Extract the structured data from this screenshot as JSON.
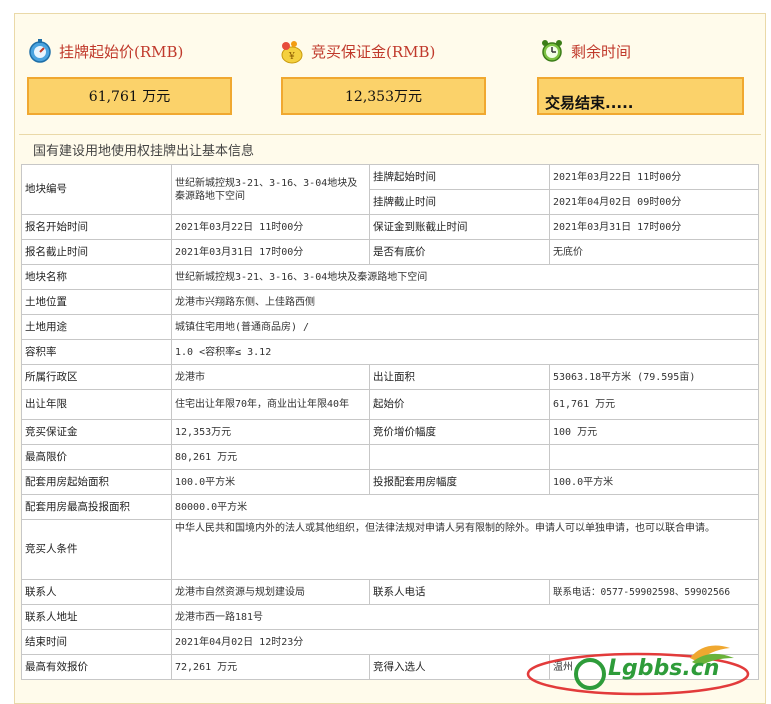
{
  "header": {
    "start_price_label": "挂牌起始价(RMB)",
    "deposit_label": "竞买保证金(RMB)",
    "remaining_label": "剩余时间",
    "start_price_value": "61,761 万元",
    "deposit_value": "12,353万元",
    "remaining_value": "交易结束....."
  },
  "section_title": "国有建设用地使用权挂牌出让基本信息",
  "rows": {
    "r1": {
      "l1": "地块编号",
      "v1": "世纪新城控规3-21、3-16、3-04地块及秦源路地下空间",
      "l2a": "挂牌起始时间",
      "v2a": "2021年03月22日 11时00分",
      "l2b": "挂牌截止时间",
      "v2b": "2021年04月02日 09时00分"
    },
    "r2": {
      "l1": "报名开始时间",
      "v1": "2021年03月22日 11时00分",
      "l2": "保证金到账截止时间",
      "v2": "2021年03月31日 17时00分"
    },
    "r3": {
      "l1": "报名截止时间",
      "v1": "2021年03月31日 17时00分",
      "l2": "是否有底价",
      "v2": "无底价"
    },
    "r4": {
      "l1": "地块名称",
      "v1": "世纪新城控规3-21、3-16、3-04地块及秦源路地下空间"
    },
    "r5": {
      "l1": "土地位置",
      "v1": "龙港市兴翔路东侧、上佳路西侧"
    },
    "r6": {
      "l1": "土地用途",
      "v1": "城镇住宅用地(普通商品房) /"
    },
    "r7": {
      "l1": "容积率",
      "v1": "1.0 <容积率≤ 3.12"
    },
    "r8": {
      "l1": "所属行政区",
      "v1": "龙港市",
      "l2": "出让面积",
      "v2": "53063.18平方米 (79.595亩)"
    },
    "r9": {
      "l1": "出让年限",
      "v1": "住宅出让年限70年，商业出让年限40年",
      "l2": "起始价",
      "v2": "61,761 万元"
    },
    "r10": {
      "l1": "竞买保证金",
      "v1": "12,353万元",
      "l2": "竞价增价幅度",
      "v2": "100 万元"
    },
    "r11": {
      "l1": "最高限价",
      "v1": "80,261 万元",
      "l2": "",
      "v2": ""
    },
    "r12": {
      "l1": "配套用房起始面积",
      "v1": "100.0平方米",
      "l2": "投报配套用房幅度",
      "v2": "100.0平方米"
    },
    "r13": {
      "l1": "配套用房最高投报面积",
      "v1": "80000.0平方米"
    },
    "r14": {
      "l1": "竞买人条件",
      "v1": "中华人民共和国境内外的法人或其他组织，但法律法规对申请人另有限制的除外。申请人可以单独申请，也可以联合申请。"
    },
    "r15": {
      "l1": "联系人",
      "v1": "龙港市自然资源与规划建设局",
      "l2": "联系人电话",
      "v2": "联系电话：0577-59902598、59902566"
    },
    "r16": {
      "l1": "联系人地址",
      "v1": "龙港市西一路181号"
    },
    "r17": {
      "l1": "结束时间",
      "v1": "2021年04月02日 12时23分"
    },
    "r18": {
      "l1": "最高有效报价",
      "v1": "72,261 万元",
      "l2": "竞得入选人",
      "v2": "温州"
    }
  },
  "watermark": {
    "text": "Lgbbs.cn"
  },
  "colors": {
    "title_red": "#c0392b",
    "box_fill": "#fbd26a",
    "box_border": "#f0a830",
    "panel_bg": "#fffbeb"
  }
}
